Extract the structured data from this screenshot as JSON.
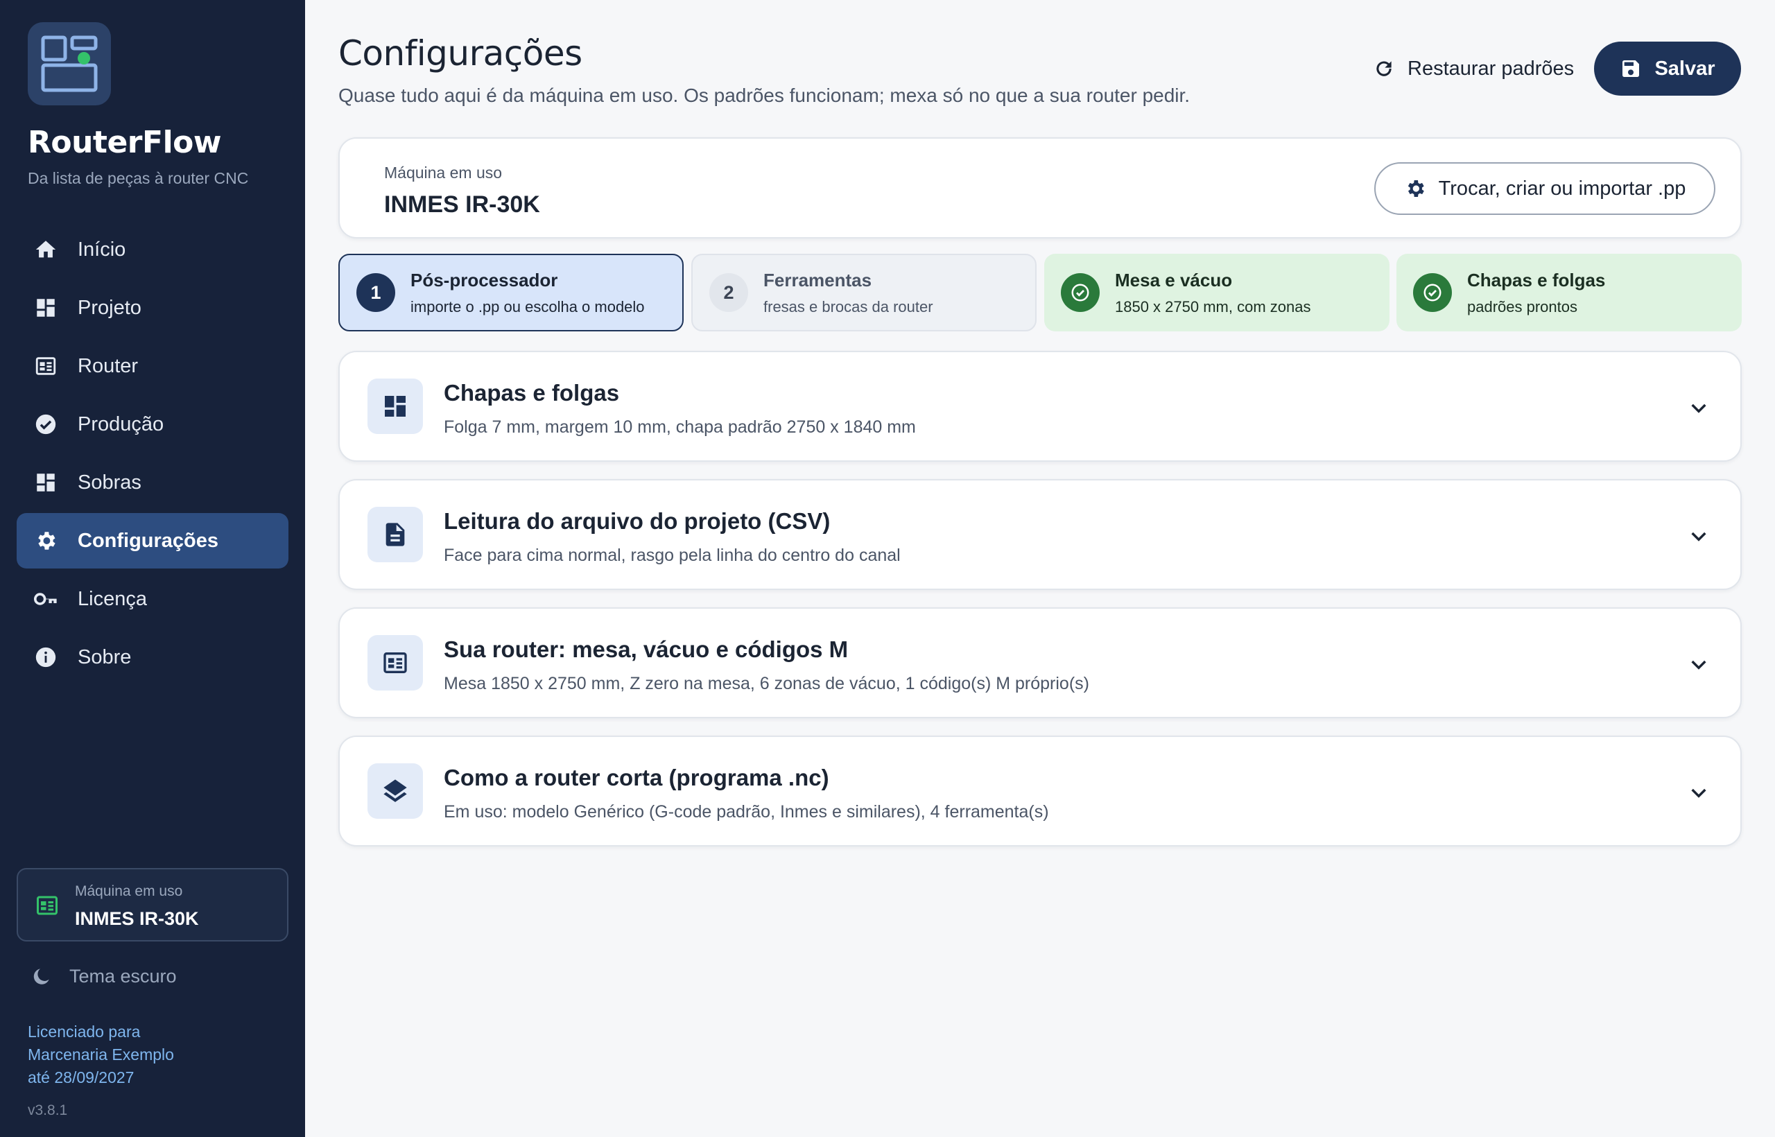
{
  "sidebar": {
    "brand": {
      "name": "RouterFlow",
      "tagline": "Da lista de peças à router CNC"
    },
    "nav": [
      {
        "label": "Início",
        "icon": "home-icon",
        "active": false
      },
      {
        "label": "Projeto",
        "icon": "dashboard-icon",
        "active": false
      },
      {
        "label": "Router",
        "icon": "router-icon",
        "active": false
      },
      {
        "label": "Produção",
        "icon": "check-circle-icon",
        "active": false
      },
      {
        "label": "Sobras",
        "icon": "dashboard-icon",
        "active": false
      },
      {
        "label": "Configurações",
        "icon": "gear-icon",
        "active": true
      },
      {
        "label": "Licença",
        "icon": "key-icon",
        "active": false
      },
      {
        "label": "Sobre",
        "icon": "info-icon",
        "active": false
      }
    ],
    "machine": {
      "label": "Máquina em uso",
      "value": "INMES IR-30K"
    },
    "theme_toggle": "Tema escuro",
    "license": {
      "line1": "Licenciado para",
      "line2": "Marcenaria Exemplo",
      "line3": "até 28/09/2027"
    },
    "version": "v3.8.1"
  },
  "header": {
    "title": "Configurações",
    "subtitle": "Quase tudo aqui é da máquina em uso. Os padrões funcionam; mexa só no que a sua router pedir.",
    "restore_label": "Restaurar padrões",
    "save_label": "Salvar"
  },
  "machine_panel": {
    "label": "Máquina em uso",
    "value": "INMES IR-30K",
    "switch_label": "Trocar, criar ou importar .pp"
  },
  "steps": [
    {
      "badge": "1",
      "title": "Pós-processador",
      "subtitle": "importe o .pp ou escolha o modelo",
      "state": "active"
    },
    {
      "badge": "2",
      "title": "Ferramentas",
      "subtitle": "fresas e brocas da router",
      "state": "pending"
    },
    {
      "badge": "",
      "title": "Mesa e vácuo",
      "subtitle": "1850 x 2750 mm, com zonas",
      "state": "done"
    },
    {
      "badge": "",
      "title": "Chapas e folgas",
      "subtitle": "padrões prontos",
      "state": "done"
    }
  ],
  "sections": [
    {
      "title": "Chapas e folgas",
      "subtitle": "Folga 7 mm, margem 10 mm, chapa padrão 2750 x 1840 mm",
      "icon": "dashboard-icon"
    },
    {
      "title": "Leitura do arquivo do projeto (CSV)",
      "subtitle": "Face para cima normal, rasgo pela linha do centro do canal",
      "icon": "document-icon"
    },
    {
      "title": "Sua router: mesa, vácuo e códigos M",
      "subtitle": "Mesa 1850 x 2750 mm, Z zero na mesa, 6 zonas de vácuo, 1 código(s) M próprio(s)",
      "icon": "router-icon"
    },
    {
      "title": "Como a router corta (programa .nc)",
      "subtitle": "Em uso: modelo Genérico (G-code padrão, Inmes e similares), 4 ferramenta(s)",
      "icon": "layers-icon"
    }
  ],
  "colors": {
    "sidebar_bg": "#17223a",
    "accent_dark": "#1e3358",
    "active_nav": "#2d4d80",
    "done_bg": "#dff3e1",
    "done_badge": "#2a7a3b",
    "link": "#7fb6ee"
  }
}
